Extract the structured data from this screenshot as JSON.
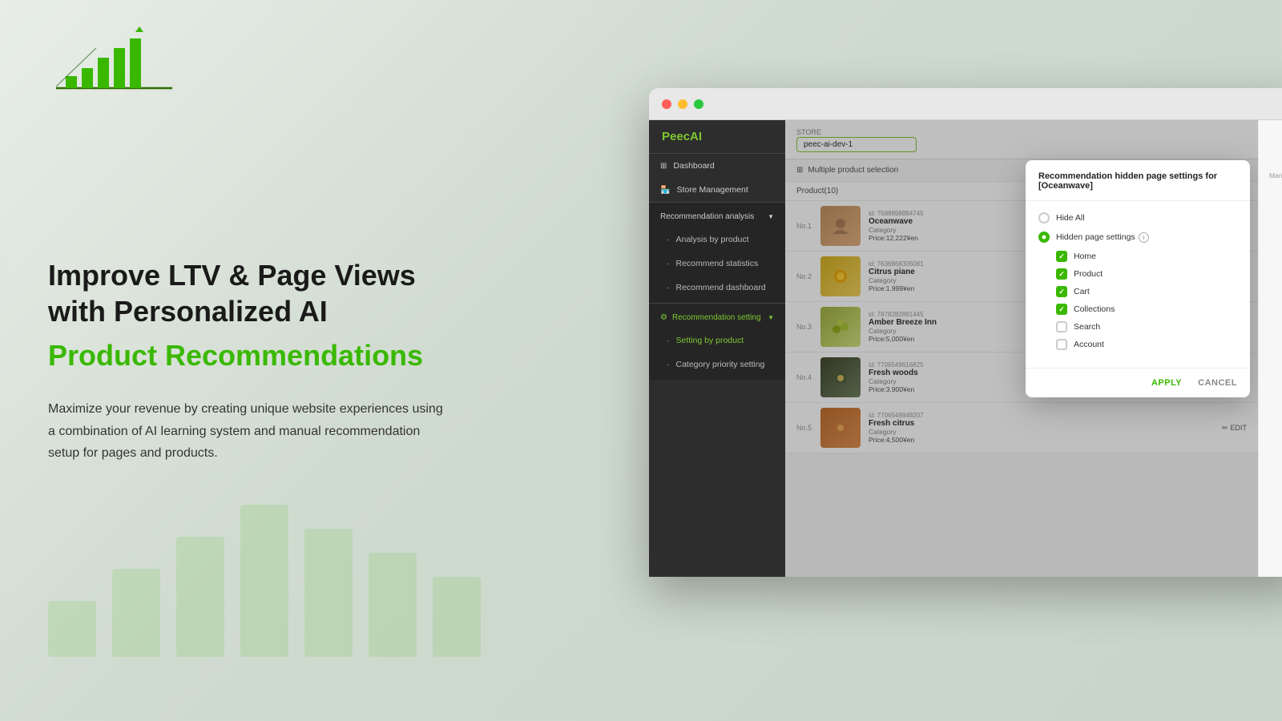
{
  "logo": {
    "alt": "PeecAI Logo"
  },
  "hero": {
    "headline_line1": "Improve LTV & Page Views",
    "headline_line2": "with Personalized AI",
    "headline_green": "Product Recommendations",
    "description": "Maximize your revenue by creating unique website experiences using a combination of AI learning system and manual recommendation setup for pages and products."
  },
  "browser": {
    "dots": [
      "#ff5f57",
      "#ffbd2e",
      "#28c840"
    ]
  },
  "sidebar": {
    "brand": "PeecAI",
    "items": [
      {
        "label": "Dashboard",
        "icon": "grid-icon",
        "active": false
      },
      {
        "label": "Store Management",
        "icon": "store-icon",
        "active": false
      },
      {
        "label": "Recommendation analysis",
        "icon": "analysis-icon",
        "active": false,
        "hasArrow": true
      },
      {
        "label": "Analysis by product",
        "sub": true,
        "active": false
      },
      {
        "label": "Recommend statistics",
        "sub": true,
        "active": false
      },
      {
        "label": "Recommend dashboard",
        "sub": true,
        "active": false
      },
      {
        "label": "Recommendation setting",
        "icon": "setting-icon",
        "active": true,
        "hasArrow": true
      },
      {
        "label": "Setting by product",
        "sub": true,
        "active": true
      },
      {
        "label": "Category priority setting",
        "sub": true,
        "active": false
      }
    ]
  },
  "main": {
    "store_label": "STORE",
    "store_value": "peec-ai-dev-1",
    "store_placeholder": "peec-ai-dev-1",
    "multi_product_label": "Multiple product selection",
    "products_header": "Product(10)",
    "products": [
      {
        "num": "No.1",
        "id": "id: 7588898884745",
        "name": "Oceanwave",
        "category": "Category",
        "price": "Price:12,222¥en",
        "color": "#c8a080"
      },
      {
        "num": "No.2",
        "id": "id: 7636868305081",
        "name": "Citrus piane",
        "category": "Category",
        "price": "Price:1,999¥en",
        "color": "#e8c840"
      },
      {
        "num": "No.3",
        "id": "id: 7878282891445",
        "name": "Amber Breeze Inn",
        "category": "Category",
        "price": "Price:5,000¥en",
        "color": "#b8c840"
      },
      {
        "num": "No.4",
        "id": "id: 7706549616825",
        "name": "Fresh woods",
        "category": "Category",
        "price": "Price:3,900¥en",
        "color": "#606855"
      },
      {
        "num": "No.5",
        "id": "id: 7706549848207",
        "name": "Fresh citrus",
        "category": "Category",
        "price": "Price:4,500¥en",
        "color": "#c88040"
      }
    ],
    "edit_label": "EDIT",
    "manage_label": "Manag..."
  },
  "modal": {
    "title": "Recommendation hidden page settings for [Oceanwave]",
    "option_hide_all": "Hide All",
    "option_hidden_settings": "Hidden page settings",
    "info_icon_label": "i",
    "checkboxes": [
      {
        "label": "Home",
        "checked": true
      },
      {
        "label": "Product",
        "checked": true
      },
      {
        "label": "Cart",
        "checked": true
      },
      {
        "label": "Collections",
        "checked": true
      },
      {
        "label": "Search",
        "checked": false
      },
      {
        "label": "Account",
        "checked": false
      }
    ],
    "btn_apply": "APPLY",
    "btn_cancel": "CANCEL"
  }
}
